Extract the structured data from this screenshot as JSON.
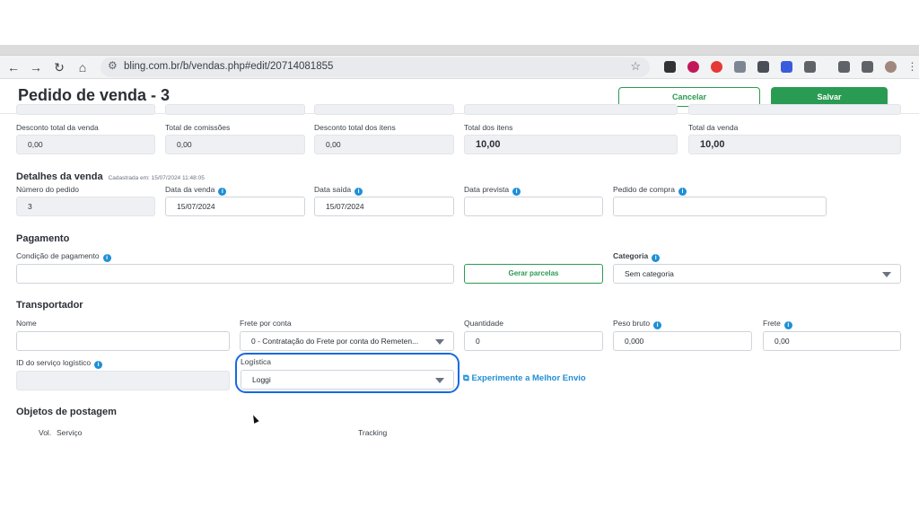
{
  "browser": {
    "url": "bling.com.br/b/vendas.php#edit/20714081855",
    "back_icon": "←",
    "forward_icon": "→",
    "reload_icon": "↻",
    "home_icon": "⌂",
    "star_icon": "☆"
  },
  "header": {
    "title": "Pedido de venda - 3",
    "cancel_label": "Cancelar",
    "save_label": "Salvar"
  },
  "totals": [
    {
      "label": "Desconto total da venda",
      "value": "0,00"
    },
    {
      "label": "Total de comissões",
      "value": "0,00"
    },
    {
      "label": "Desconto total dos itens",
      "value": "0,00"
    },
    {
      "label": "Total dos itens",
      "value": "10,00"
    },
    {
      "label": "Total da venda",
      "value": "10,00"
    }
  ],
  "details": {
    "title": "Detalhes da venda",
    "subtitle": "Cadastrada em: 15/07/2024 11:48:05",
    "order_number_label": "Número do pedido",
    "order_number": "3",
    "sale_date_label": "Data da venda",
    "sale_date": "15/07/2024",
    "exit_date_label": "Data saída",
    "exit_date": "15/07/2024",
    "expected_date_label": "Data prevista",
    "expected_date": "",
    "purchase_order_label": "Pedido de compra",
    "purchase_order": ""
  },
  "payment": {
    "title": "Pagamento",
    "condition_label": "Condição de pagamento",
    "condition": "",
    "generate_label": "Gerar parcelas",
    "category_label": "Categoria",
    "category": "Sem categoria"
  },
  "carrier": {
    "title": "Transportador",
    "name_label": "Nome",
    "name": "",
    "freight_by_label": "Frete por conta",
    "freight_by": "0 - Contratação do Frete por conta do Remeten...",
    "quantity_label": "Quantidade",
    "quantity": "0",
    "gross_weight_label": "Peso bruto",
    "gross_weight": "0,000",
    "freight_label": "Frete",
    "freight": "0,00",
    "service_id_label": "ID do serviço logístico",
    "service_id": "",
    "logistics_label": "Logística",
    "logistics": "Loggi",
    "melhor_envio_label": "Experimente a Melhor Envio"
  },
  "postage": {
    "title": "Objetos de postagem",
    "col_vol": "Vol.",
    "col_service": "Serviço",
    "col_tracking": "Tracking"
  },
  "colors": {
    "accent_green": "#2a9b52",
    "info_blue": "#1f8fd6",
    "highlight_blue": "#1769e0"
  }
}
